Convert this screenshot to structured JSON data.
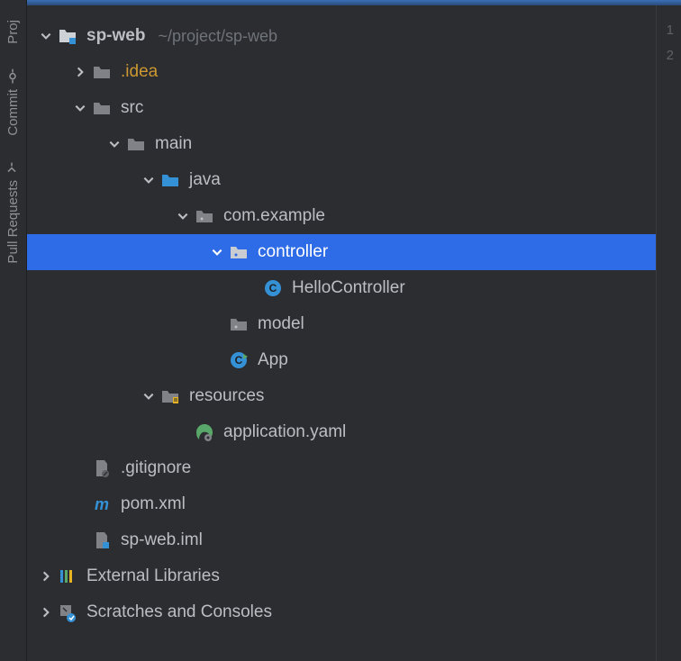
{
  "rail": {
    "project": "Proj",
    "commit": "Commit",
    "pull_requests": "Pull Requests"
  },
  "gutter": [
    "1",
    "2"
  ],
  "tree": {
    "root": {
      "name": "sp-web",
      "path": "~/project/sp-web"
    },
    "idea": ".idea",
    "src": "src",
    "main": "main",
    "java": "java",
    "pkg": "com.example",
    "controller": "controller",
    "hello": "HelloController",
    "model": "model",
    "app": "App",
    "resources": "resources",
    "appyaml": "application.yaml",
    "gitignore": ".gitignore",
    "pom": "pom.xml",
    "iml": "sp-web.iml",
    "extlib": "External Libraries",
    "scratch": "Scratches and Consoles"
  }
}
